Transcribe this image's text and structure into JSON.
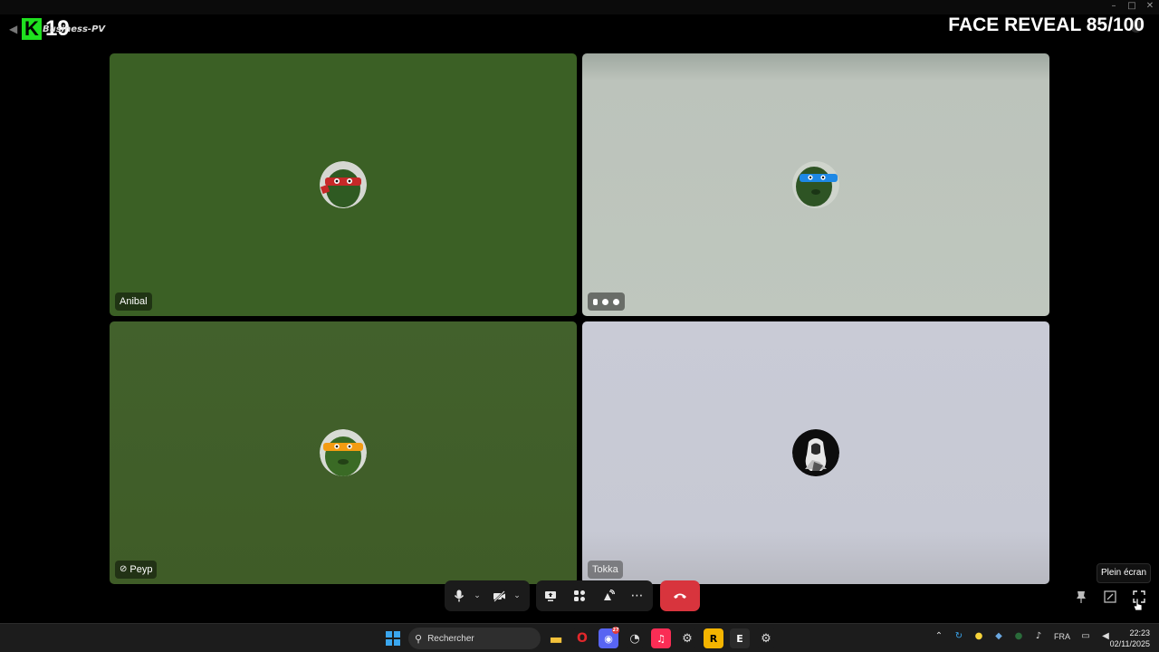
{
  "overlay": {
    "logo_text": "K",
    "logo_number": "19",
    "server_name": "Business-PV",
    "title": "FACE REVEAL 85/100"
  },
  "window": {
    "minimize_icon": "minimize-icon",
    "maximize_icon": "maximize-icon",
    "close_icon": "close-icon"
  },
  "participants": [
    {
      "name": "Anibal",
      "tile_color": "#3b6025",
      "mask_color": "#c62828",
      "muted": false
    },
    {
      "name": "",
      "tile_color": "#bcc3bb",
      "mask_color": "#1e88e5",
      "muted": false
    },
    {
      "name": "Peyp",
      "tile_color": "#42612c",
      "mask_color": "#f39c12",
      "muted": true
    },
    {
      "name": "Tokka",
      "tile_color": "#c9cbd6",
      "avatar": "dark-figure",
      "muted": false
    }
  ],
  "controls": {
    "microphone": "microphone-icon",
    "camera": "camera-off-icon",
    "share_screen": "share-screen-icon",
    "activities": "activities-icon",
    "soundboard": "soundboard-icon",
    "more": "more-icon",
    "hangup": "hangup-icon",
    "hangup_color": "#d8343d",
    "pin": "pin-icon",
    "popout": "popout-icon",
    "fullscreen": "fullscreen-icon",
    "tooltip": "Plein écran"
  },
  "taskbar": {
    "search_placeholder": "Rechercher",
    "apps": [
      {
        "name": "file-explorer-icon",
        "color": "#f3c13a",
        "glyph": "▬"
      },
      {
        "name": "opera-icon",
        "color": "#1c1c1c",
        "glyph": "O"
      },
      {
        "name": "discord-icon",
        "color": "#5865f2",
        "glyph": "◉",
        "badge": "27"
      },
      {
        "name": "speedtest-icon",
        "color": "#1c1c1c",
        "glyph": "◔"
      },
      {
        "name": "music-icon",
        "color": "#fa2d55",
        "glyph": "♫"
      },
      {
        "name": "steam-icon",
        "color": "#1c1c1c",
        "glyph": "⚙"
      },
      {
        "name": "rockstar-icon",
        "color": "#f4b400",
        "glyph": "R"
      },
      {
        "name": "epic-games-icon",
        "color": "#2b2b2b",
        "glyph": "E"
      },
      {
        "name": "settings-icon",
        "color": "#1c1c1c",
        "glyph": "⚙"
      }
    ],
    "language": "FRA",
    "time": "22:23",
    "date": "02/11/2025"
  }
}
